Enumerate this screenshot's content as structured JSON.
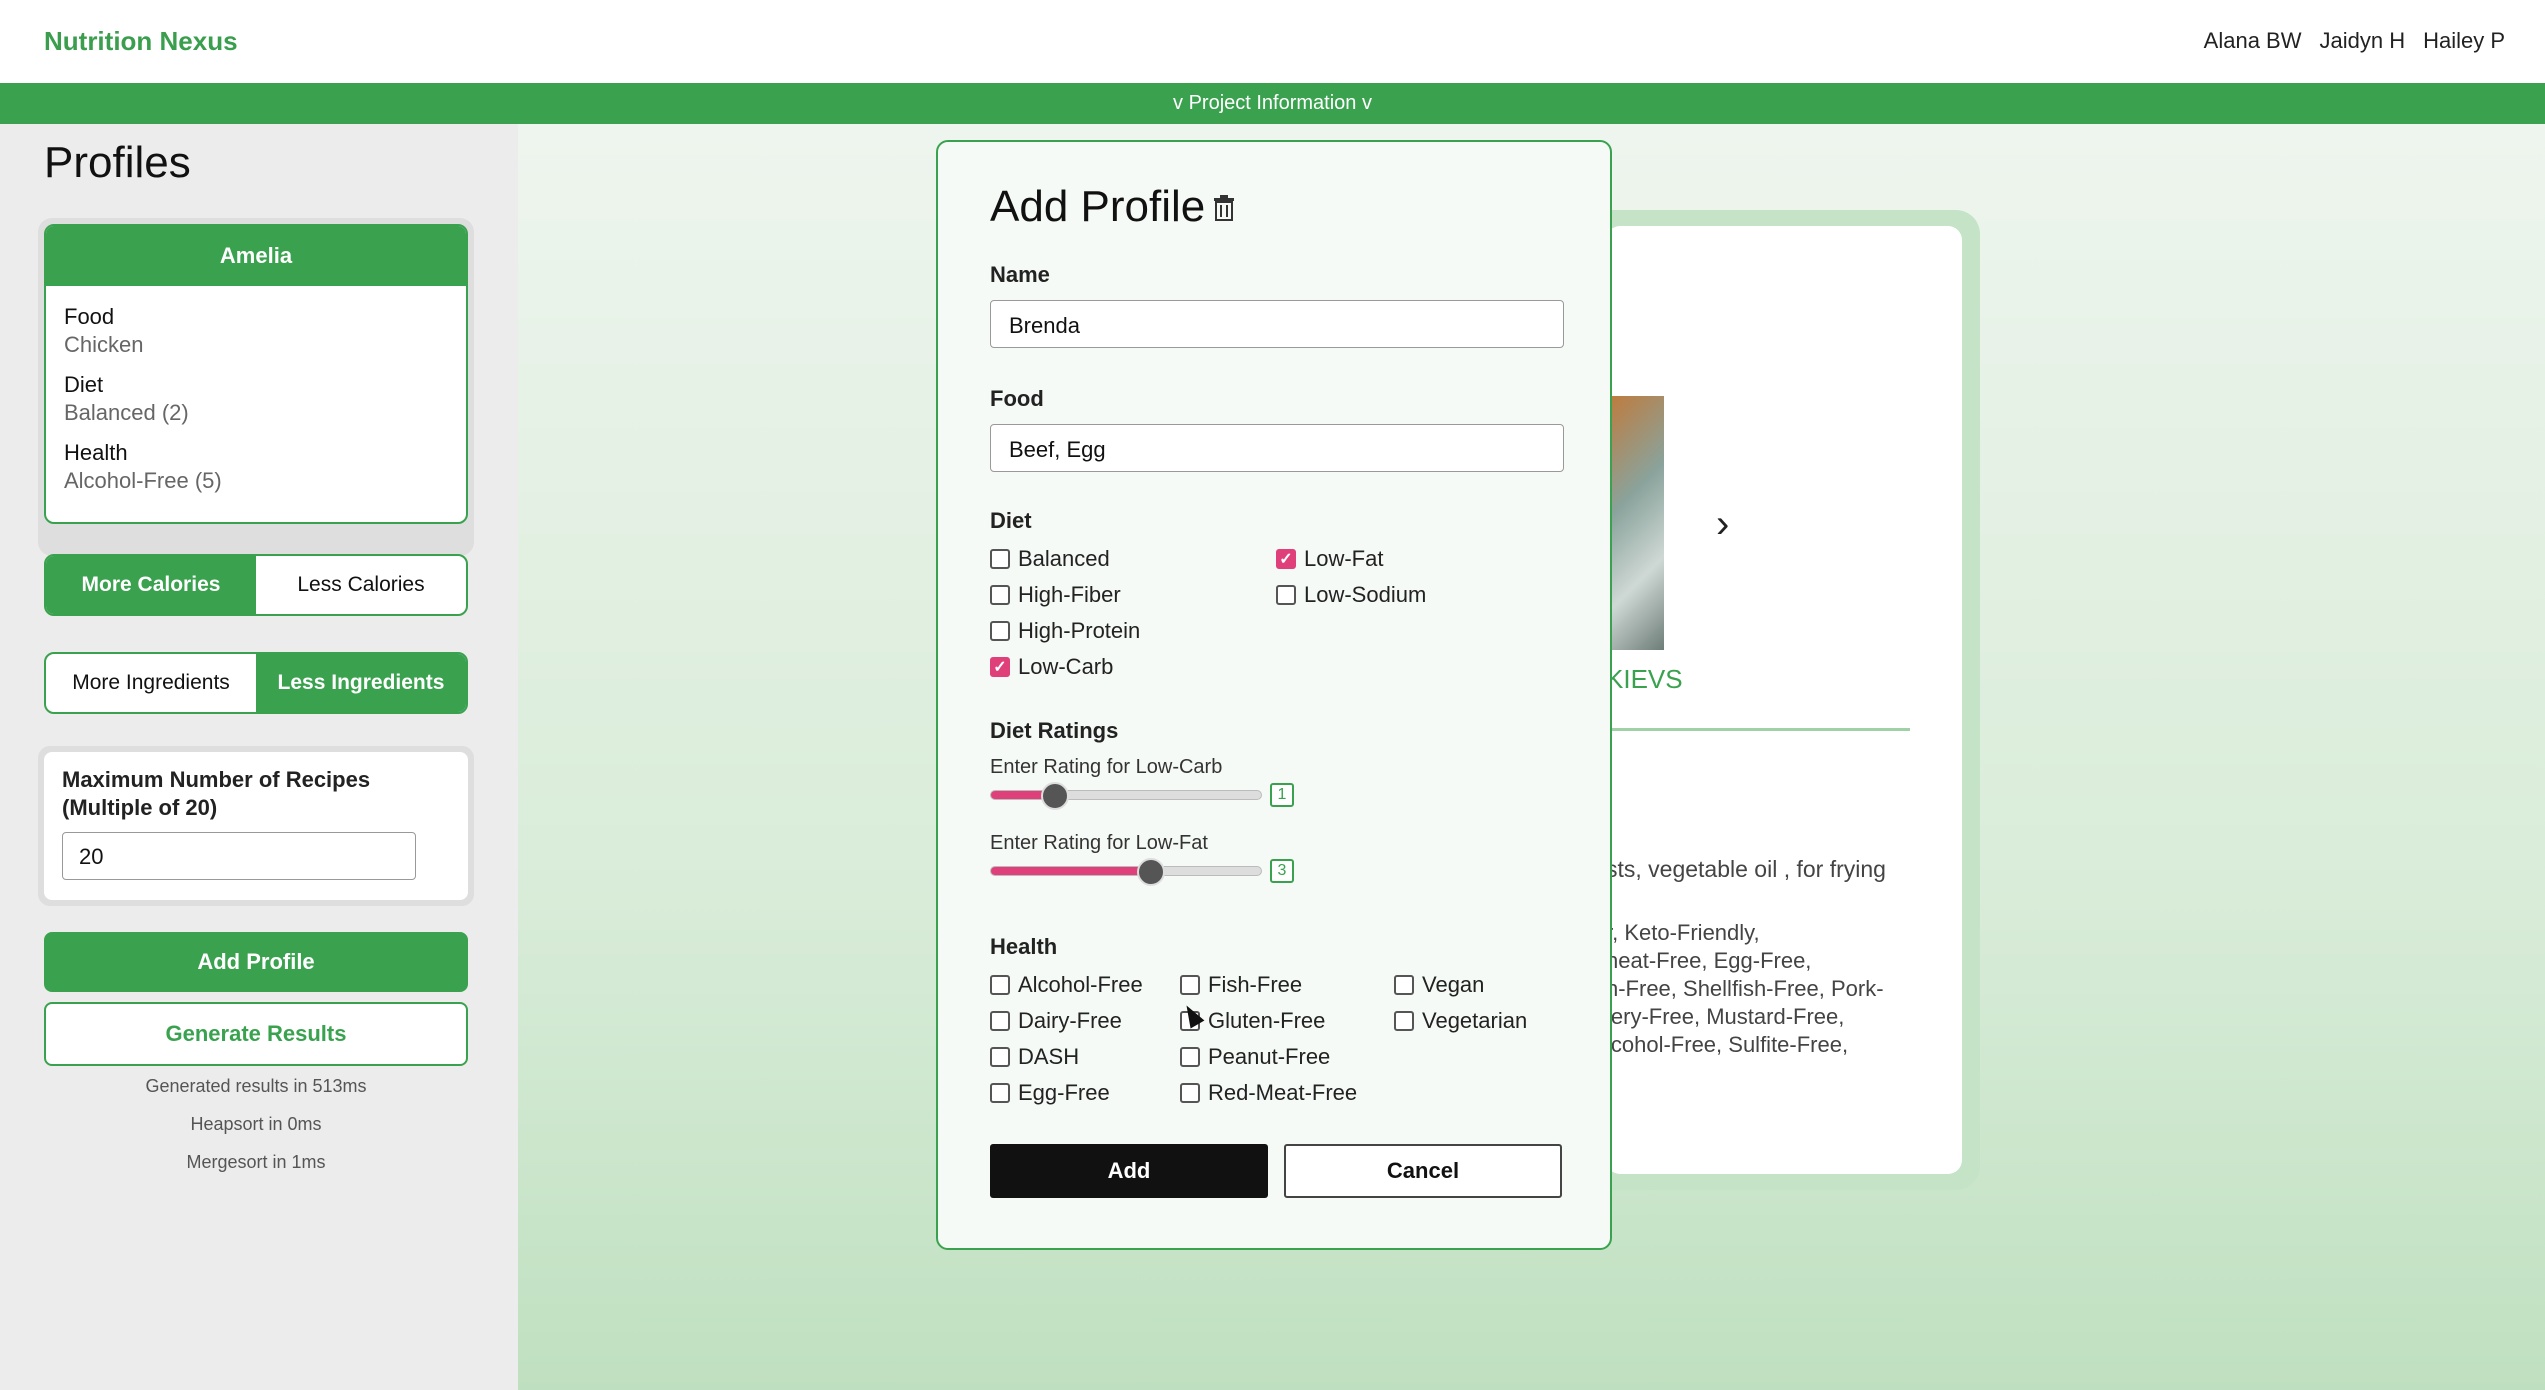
{
  "app": {
    "brand": "Nutrition Nexus",
    "team": [
      "Alana BW",
      "Jaidyn H",
      "Hailey P"
    ],
    "project_bar": "v Project Information v"
  },
  "sidebar": {
    "title": "Profiles",
    "profile": {
      "name": "Amelia",
      "food_label": "Food",
      "food_value": "Chicken",
      "diet_label": "Diet",
      "diet_value": "Balanced (2)",
      "health_label": "Health",
      "health_value": "Alcohol-Free (5)"
    },
    "calories": {
      "more": "More Calories",
      "less": "Less Calories",
      "selected": "more"
    },
    "ingredients": {
      "more": "More Ingredients",
      "less": "Less Ingredients",
      "selected": "less"
    },
    "max_recipes": {
      "label": "Maximum Number of Recipes (Multiple of 20)",
      "value": "20"
    },
    "add_profile": "Add Profile",
    "generate": "Generate Results",
    "stats": [
      "Generated results in 513ms",
      "Heapsort in 0ms",
      "Mergesort in 1ms"
    ]
  },
  "result": {
    "title": "KIEVS",
    "ingredients_fragment": "sts, vegetable oil , for frying",
    "labels_fragments": [
      "r, Keto-Friendly,",
      "heat-Free, Egg-Free,",
      "n-Free, Shellfish-Free, Pork-",
      "lery-Free, Mustard-Free,",
      "lcohol-Free, Sulfite-Free,"
    ]
  },
  "modal": {
    "title": "Add Profile",
    "name_label": "Name",
    "name_value": "Brenda",
    "food_label": "Food",
    "food_value": "Beef, Egg",
    "diet_label": "Diet",
    "diet_options": [
      {
        "label": "Balanced",
        "checked": false
      },
      {
        "label": "High-Fiber",
        "checked": false
      },
      {
        "label": "High-Protein",
        "checked": false
      },
      {
        "label": "Low-Carb",
        "checked": true
      },
      {
        "label": "Low-Fat",
        "checked": true
      },
      {
        "label": "Low-Sodium",
        "checked": false
      }
    ],
    "ratings_label": "Diet Ratings",
    "ratings": [
      {
        "label": "Enter Rating for Low-Carb",
        "value": "1",
        "fraction": 0.24
      },
      {
        "label": "Enter Rating for Low-Fat",
        "value": "3",
        "fraction": 0.59
      }
    ],
    "health_label": "Health",
    "health_options": [
      "Alcohol-Free",
      "Dairy-Free",
      "DASH",
      "Egg-Free",
      "Fish-Free",
      "Gluten-Free",
      "Peanut-Free",
      "Red-Meat-Free",
      "Vegan",
      "Vegetarian"
    ],
    "add": "Add",
    "cancel": "Cancel"
  }
}
